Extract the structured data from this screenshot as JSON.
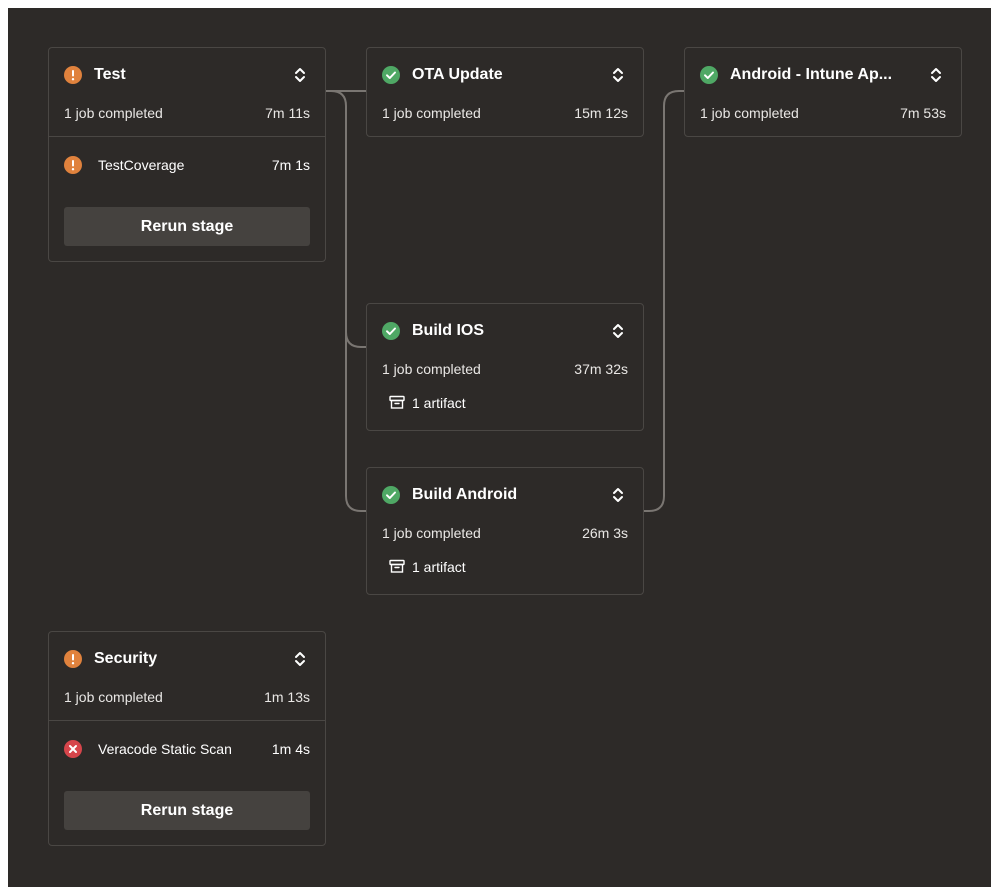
{
  "colors": {
    "canvas_background": "#2d2a28",
    "card_border": "#4a4744",
    "connector": "#7a7672",
    "warning": "#e0823d",
    "success": "#4fa865",
    "error": "#d6454b",
    "button_background": "#45423f"
  },
  "stages": {
    "test": {
      "status_icon": "warning-icon",
      "title": "Test",
      "summary": "1 job completed",
      "duration": "7m 11s",
      "jobs": [
        {
          "status_icon": "warning-icon",
          "name": "TestCoverage",
          "duration": "7m 1s"
        }
      ],
      "rerun_label": "Rerun stage"
    },
    "ota_update": {
      "status_icon": "check-icon",
      "title": "OTA Update",
      "summary": "1 job completed",
      "duration": "15m 12s"
    },
    "android_intune": {
      "status_icon": "check-icon",
      "title": "Android - Intune Ap...",
      "summary": "1 job completed",
      "duration": "7m 53s"
    },
    "build_ios": {
      "status_icon": "check-icon",
      "title": "Build IOS",
      "summary": "1 job completed",
      "duration": "37m 32s",
      "artifact_icon": "archive-icon",
      "artifact_label": "1 artifact"
    },
    "build_android": {
      "status_icon": "check-icon",
      "title": "Build Android",
      "summary": "1 job completed",
      "duration": "26m 3s",
      "artifact_icon": "archive-icon",
      "artifact_label": "1 artifact"
    },
    "security": {
      "status_icon": "warning-icon",
      "title": "Security",
      "summary": "1 job completed",
      "duration": "1m 13s",
      "jobs": [
        {
          "status_icon": "error-icon",
          "name": "Veracode Static Scan",
          "duration": "1m 4s"
        }
      ],
      "rerun_label": "Rerun stage"
    }
  }
}
